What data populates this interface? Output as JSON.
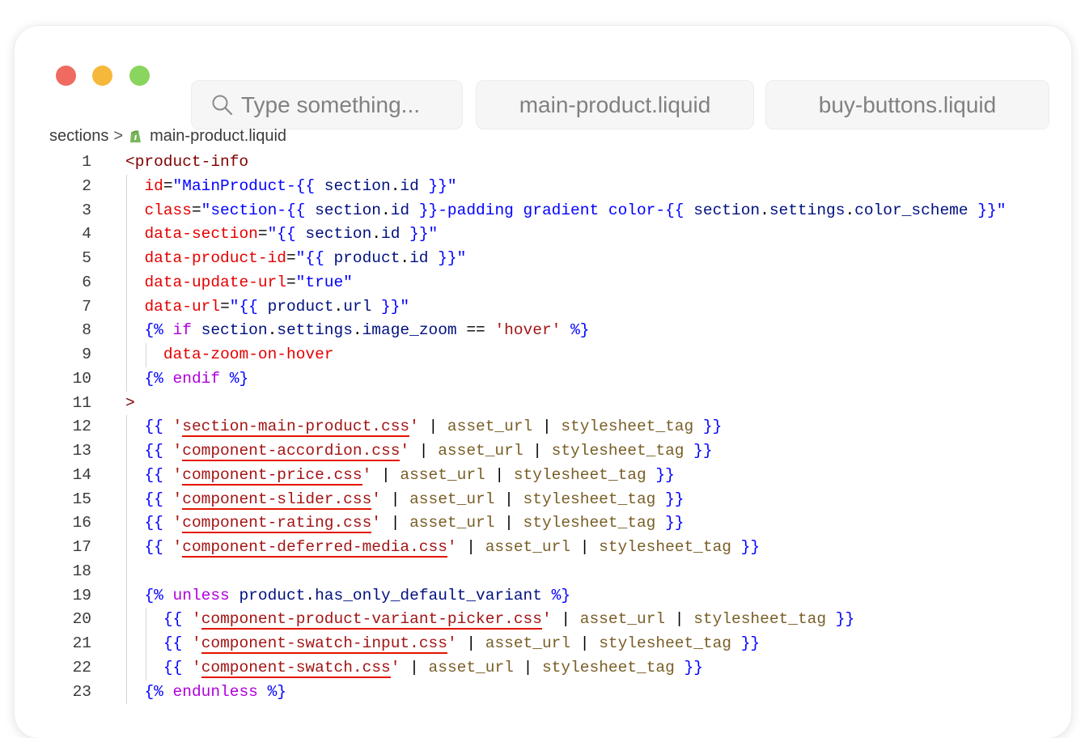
{
  "window": {
    "search": {
      "placeholder": "Type something..."
    },
    "tabs": [
      {
        "label": "main-product.liquid"
      },
      {
        "label": "buy-buttons.liquid"
      }
    ]
  },
  "breadcrumb": {
    "folder": "sections",
    "separator": ">",
    "file": "main-product.liquid"
  },
  "theme": {
    "tag": "#800000",
    "attribute": "#e50000",
    "string": "#0000ff",
    "variable": "#001080",
    "control_keyword": "#af00db",
    "filter": "#795e26",
    "liquid_string": "#a31515"
  },
  "code": [
    {
      "n": "1",
      "indent": 0,
      "tokens": [
        [
          "tag",
          "<product-info"
        ]
      ]
    },
    {
      "n": "2",
      "indent": 1,
      "tokens": [
        [
          "attr",
          "id"
        ],
        [
          "punc",
          "="
        ],
        [
          "str",
          "\"MainProduct-"
        ],
        [
          "brace",
          "{{ "
        ],
        [
          "var",
          "section"
        ],
        [
          "punc",
          "."
        ],
        [
          "var",
          "id"
        ],
        [
          "brace",
          " }}"
        ],
        [
          "str",
          "\""
        ]
      ]
    },
    {
      "n": "3",
      "indent": 1,
      "tokens": [
        [
          "attr",
          "class"
        ],
        [
          "punc",
          "="
        ],
        [
          "str",
          "\"section-"
        ],
        [
          "brace",
          "{{ "
        ],
        [
          "var",
          "section"
        ],
        [
          "punc",
          "."
        ],
        [
          "var",
          "id"
        ],
        [
          "brace",
          " }}"
        ],
        [
          "str",
          "-padding gradient color-"
        ],
        [
          "brace",
          "{{ "
        ],
        [
          "var",
          "section"
        ],
        [
          "punc",
          "."
        ],
        [
          "var",
          "settings"
        ],
        [
          "punc",
          "."
        ],
        [
          "var",
          "color_scheme"
        ],
        [
          "brace",
          " }}"
        ],
        [
          "str",
          "\""
        ]
      ]
    },
    {
      "n": "4",
      "indent": 1,
      "tokens": [
        [
          "attr",
          "data-section"
        ],
        [
          "punc",
          "="
        ],
        [
          "str",
          "\""
        ],
        [
          "brace",
          "{{ "
        ],
        [
          "var",
          "section"
        ],
        [
          "punc",
          "."
        ],
        [
          "var",
          "id"
        ],
        [
          "brace",
          " }}"
        ],
        [
          "str",
          "\""
        ]
      ]
    },
    {
      "n": "5",
      "indent": 1,
      "tokens": [
        [
          "attr",
          "data-product-id"
        ],
        [
          "punc",
          "="
        ],
        [
          "str",
          "\""
        ],
        [
          "brace",
          "{{ "
        ],
        [
          "var",
          "product"
        ],
        [
          "punc",
          "."
        ],
        [
          "var",
          "id"
        ],
        [
          "brace",
          " }}"
        ],
        [
          "str",
          "\""
        ]
      ]
    },
    {
      "n": "6",
      "indent": 1,
      "tokens": [
        [
          "attr",
          "data-update-url"
        ],
        [
          "punc",
          "="
        ],
        [
          "str",
          "\"true\""
        ]
      ]
    },
    {
      "n": "7",
      "indent": 1,
      "tokens": [
        [
          "attr",
          "data-url"
        ],
        [
          "punc",
          "="
        ],
        [
          "str",
          "\""
        ],
        [
          "brace",
          "{{ "
        ],
        [
          "var",
          "product"
        ],
        [
          "punc",
          "."
        ],
        [
          "var",
          "url"
        ],
        [
          "brace",
          " }}"
        ],
        [
          "str",
          "\""
        ]
      ]
    },
    {
      "n": "8",
      "indent": 1,
      "tokens": [
        [
          "brace",
          "{% "
        ],
        [
          "ctrl",
          "if"
        ],
        [
          "punc",
          " "
        ],
        [
          "var",
          "section"
        ],
        [
          "punc",
          "."
        ],
        [
          "var",
          "settings"
        ],
        [
          "punc",
          "."
        ],
        [
          "var",
          "image_zoom"
        ],
        [
          "punc",
          " "
        ],
        [
          "op",
          "=="
        ],
        [
          "punc",
          " "
        ],
        [
          "lstr",
          "'hover'"
        ],
        [
          "brace",
          " %}"
        ]
      ]
    },
    {
      "n": "9",
      "indent": 2,
      "tokens": [
        [
          "attr",
          "data-zoom-on-hover"
        ]
      ]
    },
    {
      "n": "10",
      "indent": 1,
      "tokens": [
        [
          "brace",
          "{% "
        ],
        [
          "ctrl",
          "endif"
        ],
        [
          "brace",
          " %}"
        ]
      ]
    },
    {
      "n": "11",
      "indent": 0,
      "tokens": [
        [
          "tag",
          ">"
        ]
      ]
    },
    {
      "n": "12",
      "indent": 1,
      "tokens": [
        [
          "brace",
          "{{ "
        ],
        [
          "lstr",
          "'"
        ],
        [
          "css",
          "section-main-product.css"
        ],
        [
          "lstr",
          "'"
        ],
        [
          "punc",
          " | "
        ],
        [
          "filter",
          "asset_url"
        ],
        [
          "punc",
          " | "
        ],
        [
          "filter",
          "stylesheet_tag"
        ],
        [
          "brace",
          " }}"
        ]
      ]
    },
    {
      "n": "13",
      "indent": 1,
      "tokens": [
        [
          "brace",
          "{{ "
        ],
        [
          "lstr",
          "'"
        ],
        [
          "css",
          "component-accordion.css"
        ],
        [
          "lstr",
          "'"
        ],
        [
          "punc",
          " | "
        ],
        [
          "filter",
          "asset_url"
        ],
        [
          "punc",
          " | "
        ],
        [
          "filter",
          "stylesheet_tag"
        ],
        [
          "brace",
          " }}"
        ]
      ]
    },
    {
      "n": "14",
      "indent": 1,
      "tokens": [
        [
          "brace",
          "{{ "
        ],
        [
          "lstr",
          "'"
        ],
        [
          "css",
          "component-price.css"
        ],
        [
          "lstr",
          "'"
        ],
        [
          "punc",
          " | "
        ],
        [
          "filter",
          "asset_url"
        ],
        [
          "punc",
          " | "
        ],
        [
          "filter",
          "stylesheet_tag"
        ],
        [
          "brace",
          " }}"
        ]
      ]
    },
    {
      "n": "15",
      "indent": 1,
      "tokens": [
        [
          "brace",
          "{{ "
        ],
        [
          "lstr",
          "'"
        ],
        [
          "css",
          "component-slider.css"
        ],
        [
          "lstr",
          "'"
        ],
        [
          "punc",
          " | "
        ],
        [
          "filter",
          "asset_url"
        ],
        [
          "punc",
          " | "
        ],
        [
          "filter",
          "stylesheet_tag"
        ],
        [
          "brace",
          " }}"
        ]
      ]
    },
    {
      "n": "16",
      "indent": 1,
      "tokens": [
        [
          "brace",
          "{{ "
        ],
        [
          "lstr",
          "'"
        ],
        [
          "css",
          "component-rating.css"
        ],
        [
          "lstr",
          "'"
        ],
        [
          "punc",
          " | "
        ],
        [
          "filter",
          "asset_url"
        ],
        [
          "punc",
          " | "
        ],
        [
          "filter",
          "stylesheet_tag"
        ],
        [
          "brace",
          " }}"
        ]
      ]
    },
    {
      "n": "17",
      "indent": 1,
      "tokens": [
        [
          "brace",
          "{{ "
        ],
        [
          "lstr",
          "'"
        ],
        [
          "css",
          "component-deferred-media.css"
        ],
        [
          "lstr",
          "'"
        ],
        [
          "punc",
          " | "
        ],
        [
          "filter",
          "asset_url"
        ],
        [
          "punc",
          " | "
        ],
        [
          "filter",
          "stylesheet_tag"
        ],
        [
          "brace",
          " }}"
        ]
      ]
    },
    {
      "n": "18",
      "indent": 1,
      "tokens": []
    },
    {
      "n": "19",
      "indent": 1,
      "tokens": [
        [
          "brace",
          "{% "
        ],
        [
          "ctrl",
          "unless"
        ],
        [
          "punc",
          " "
        ],
        [
          "var",
          "product"
        ],
        [
          "punc",
          "."
        ],
        [
          "var",
          "has_only_default_variant"
        ],
        [
          "brace",
          " %}"
        ]
      ]
    },
    {
      "n": "20",
      "indent": 2,
      "tokens": [
        [
          "brace",
          "{{ "
        ],
        [
          "lstr",
          "'"
        ],
        [
          "css",
          "component-product-variant-picker.css"
        ],
        [
          "lstr",
          "'"
        ],
        [
          "punc",
          " | "
        ],
        [
          "filter",
          "asset_url"
        ],
        [
          "punc",
          " | "
        ],
        [
          "filter",
          "stylesheet_tag"
        ],
        [
          "brace",
          " }}"
        ]
      ]
    },
    {
      "n": "21",
      "indent": 2,
      "tokens": [
        [
          "brace",
          "{{ "
        ],
        [
          "lstr",
          "'"
        ],
        [
          "css",
          "component-swatch-input.css"
        ],
        [
          "lstr",
          "'"
        ],
        [
          "punc",
          " | "
        ],
        [
          "filter",
          "asset_url"
        ],
        [
          "punc",
          " | "
        ],
        [
          "filter",
          "stylesheet_tag"
        ],
        [
          "brace",
          " }}"
        ]
      ]
    },
    {
      "n": "22",
      "indent": 2,
      "tokens": [
        [
          "brace",
          "{{ "
        ],
        [
          "lstr",
          "'"
        ],
        [
          "css",
          "component-swatch.css"
        ],
        [
          "lstr",
          "'"
        ],
        [
          "punc",
          " | "
        ],
        [
          "filter",
          "asset_url"
        ],
        [
          "punc",
          " | "
        ],
        [
          "filter",
          "stylesheet_tag"
        ],
        [
          "brace",
          " }}"
        ]
      ]
    },
    {
      "n": "23",
      "indent": 1,
      "tokens": [
        [
          "brace",
          "{% "
        ],
        [
          "ctrl",
          "endunless"
        ],
        [
          "brace",
          " %}"
        ]
      ]
    }
  ]
}
